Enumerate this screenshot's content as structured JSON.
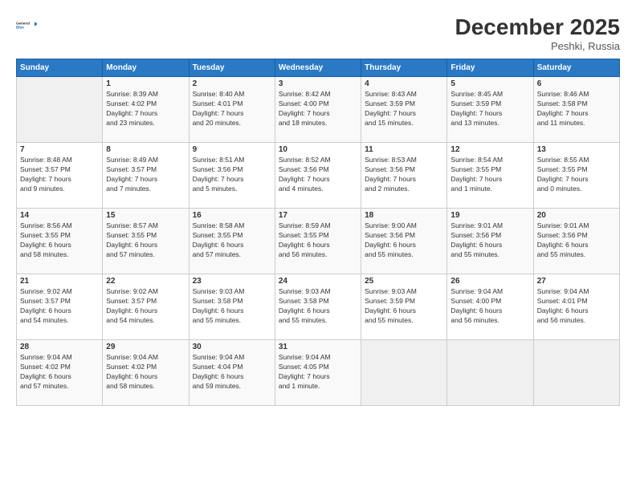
{
  "logo": {
    "line1": "General",
    "line2": "Blue"
  },
  "title": "December 2025",
  "location": "Peshki, Russia",
  "days_header": [
    "Sunday",
    "Monday",
    "Tuesday",
    "Wednesday",
    "Thursday",
    "Friday",
    "Saturday"
  ],
  "weeks": [
    [
      {
        "day": "",
        "info": ""
      },
      {
        "day": "1",
        "info": "Sunrise: 8:39 AM\nSunset: 4:02 PM\nDaylight: 7 hours\nand 23 minutes."
      },
      {
        "day": "2",
        "info": "Sunrise: 8:40 AM\nSunset: 4:01 PM\nDaylight: 7 hours\nand 20 minutes."
      },
      {
        "day": "3",
        "info": "Sunrise: 8:42 AM\nSunset: 4:00 PM\nDaylight: 7 hours\nand 18 minutes."
      },
      {
        "day": "4",
        "info": "Sunrise: 8:43 AM\nSunset: 3:59 PM\nDaylight: 7 hours\nand 15 minutes."
      },
      {
        "day": "5",
        "info": "Sunrise: 8:45 AM\nSunset: 3:59 PM\nDaylight: 7 hours\nand 13 minutes."
      },
      {
        "day": "6",
        "info": "Sunrise: 8:46 AM\nSunset: 3:58 PM\nDaylight: 7 hours\nand 11 minutes."
      }
    ],
    [
      {
        "day": "7",
        "info": "Sunrise: 8:48 AM\nSunset: 3:57 PM\nDaylight: 7 hours\nand 9 minutes."
      },
      {
        "day": "8",
        "info": "Sunrise: 8:49 AM\nSunset: 3:57 PM\nDaylight: 7 hours\nand 7 minutes."
      },
      {
        "day": "9",
        "info": "Sunrise: 8:51 AM\nSunset: 3:56 PM\nDaylight: 7 hours\nand 5 minutes."
      },
      {
        "day": "10",
        "info": "Sunrise: 8:52 AM\nSunset: 3:56 PM\nDaylight: 7 hours\nand 4 minutes."
      },
      {
        "day": "11",
        "info": "Sunrise: 8:53 AM\nSunset: 3:56 PM\nDaylight: 7 hours\nand 2 minutes."
      },
      {
        "day": "12",
        "info": "Sunrise: 8:54 AM\nSunset: 3:55 PM\nDaylight: 7 hours\nand 1 minute."
      },
      {
        "day": "13",
        "info": "Sunrise: 8:55 AM\nSunset: 3:55 PM\nDaylight: 7 hours\nand 0 minutes."
      }
    ],
    [
      {
        "day": "14",
        "info": "Sunrise: 8:56 AM\nSunset: 3:55 PM\nDaylight: 6 hours\nand 58 minutes."
      },
      {
        "day": "15",
        "info": "Sunrise: 8:57 AM\nSunset: 3:55 PM\nDaylight: 6 hours\nand 57 minutes."
      },
      {
        "day": "16",
        "info": "Sunrise: 8:58 AM\nSunset: 3:55 PM\nDaylight: 6 hours\nand 57 minutes."
      },
      {
        "day": "17",
        "info": "Sunrise: 8:59 AM\nSunset: 3:55 PM\nDaylight: 6 hours\nand 56 minutes."
      },
      {
        "day": "18",
        "info": "Sunrise: 9:00 AM\nSunset: 3:56 PM\nDaylight: 6 hours\nand 55 minutes."
      },
      {
        "day": "19",
        "info": "Sunrise: 9:01 AM\nSunset: 3:56 PM\nDaylight: 6 hours\nand 55 minutes."
      },
      {
        "day": "20",
        "info": "Sunrise: 9:01 AM\nSunset: 3:56 PM\nDaylight: 6 hours\nand 55 minutes."
      }
    ],
    [
      {
        "day": "21",
        "info": "Sunrise: 9:02 AM\nSunset: 3:57 PM\nDaylight: 6 hours\nand 54 minutes."
      },
      {
        "day": "22",
        "info": "Sunrise: 9:02 AM\nSunset: 3:57 PM\nDaylight: 6 hours\nand 54 minutes."
      },
      {
        "day": "23",
        "info": "Sunrise: 9:03 AM\nSunset: 3:58 PM\nDaylight: 6 hours\nand 55 minutes."
      },
      {
        "day": "24",
        "info": "Sunrise: 9:03 AM\nSunset: 3:58 PM\nDaylight: 6 hours\nand 55 minutes."
      },
      {
        "day": "25",
        "info": "Sunrise: 9:03 AM\nSunset: 3:59 PM\nDaylight: 6 hours\nand 55 minutes."
      },
      {
        "day": "26",
        "info": "Sunrise: 9:04 AM\nSunset: 4:00 PM\nDaylight: 6 hours\nand 56 minutes."
      },
      {
        "day": "27",
        "info": "Sunrise: 9:04 AM\nSunset: 4:01 PM\nDaylight: 6 hours\nand 56 minutes."
      }
    ],
    [
      {
        "day": "28",
        "info": "Sunrise: 9:04 AM\nSunset: 4:02 PM\nDaylight: 6 hours\nand 57 minutes."
      },
      {
        "day": "29",
        "info": "Sunrise: 9:04 AM\nSunset: 4:02 PM\nDaylight: 6 hours\nand 58 minutes."
      },
      {
        "day": "30",
        "info": "Sunrise: 9:04 AM\nSunset: 4:04 PM\nDaylight: 6 hours\nand 59 minutes."
      },
      {
        "day": "31",
        "info": "Sunrise: 9:04 AM\nSunset: 4:05 PM\nDaylight: 7 hours\nand 1 minute."
      },
      {
        "day": "",
        "info": ""
      },
      {
        "day": "",
        "info": ""
      },
      {
        "day": "",
        "info": ""
      }
    ]
  ]
}
